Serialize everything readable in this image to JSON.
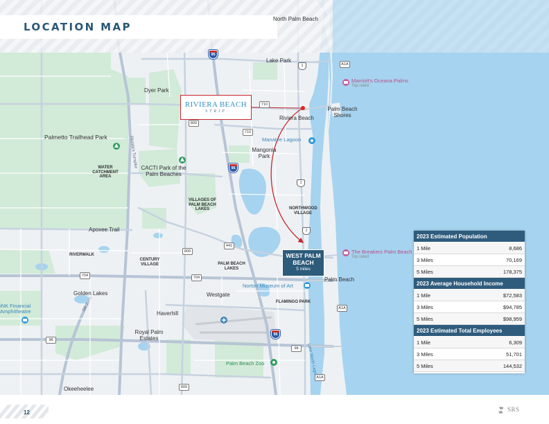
{
  "header": {
    "title": "LOCATION MAP"
  },
  "logos": {
    "riviera_name": "RIVIERA BEACH",
    "riviera_sub": "STRIP"
  },
  "target": {
    "name_line1": "WEST PALM",
    "name_line2": "BEACH",
    "distance": "5 miles"
  },
  "map_labels": {
    "north_palm_beach": "North Palm Beach",
    "lake_park": "Lake Park",
    "dyer_park": "Dyer Park",
    "palm_beach_shores": "Palm Beach Shores",
    "riviera_beach": "Riviera Beach",
    "palmetto_trailhead": "Palmetto Trailhead Park",
    "manatee_lagoon": "Manatee Lagoon",
    "mangonia_park": "Mangonia Park",
    "water_catchment": "WATER CATCHMENT AREA",
    "cacti_park": "CACTI Park of the Palm Beaches",
    "villages": "VILLAGES OF PALM BEACH LAKES",
    "northwood": "NORTHWOOD VILLAGE",
    "apoxee": "Apoxee Trail",
    "riverwalk": "RIVERWALK",
    "century_village": "CENTURY VILLAGE",
    "palm_beach_lakes": "PALM BEACH LAKES",
    "norton": "Norton Museum of Art",
    "palm_beach": "Palm Beach",
    "golden_lakes": "Golden Lakes",
    "westgate": "Westgate",
    "flamingo_park": "FLAMINGO PARK",
    "ink_financial": "iNK Financial Amphitheatre",
    "haverhill": "Haverhill",
    "royal_palm_estates": "Royal Palm Estates",
    "palm_beach_zoo": "Palm Beach Zoo",
    "okeeheelee": "Okeeheelee",
    "marriott": "Marriott's Oceana Palms",
    "marriott_sub": "Top rated",
    "breakers": "The Breakers Palm Beach",
    "breakers_sub": "Top rated",
    "lake_worth_lagoon": "Lake Worth Lagoon",
    "florida_tpk": "Florida's Turnpike",
    "sr7": "SR 7"
  },
  "road_shields": {
    "i95_a": "95",
    "i95_b": "95",
    "i95_c": "95",
    "us1_a": "1",
    "us1_b": "1",
    "us1_c": "1",
    "a1a_a": "A1A",
    "a1a_b": "A1A",
    "a1a_c": "A1A",
    "sr710_a": "710",
    "sr710_b": "710",
    "sr809_a": "809",
    "sr809_b": "809",
    "sr809_c": "809",
    "sr704_a": "704",
    "sr704_b": "704",
    "sr98_a": "98",
    "sr98_b": "98",
    "sr441": "441"
  },
  "demographics": {
    "population": {
      "title": "2023 Estimated Population",
      "rows": [
        {
          "label": "1 Mile",
          "value": "8,686"
        },
        {
          "label": "3 Miles",
          "value": "70,169"
        },
        {
          "label": "5 Miles",
          "value": "178,375"
        }
      ]
    },
    "income": {
      "title": "2023 Average Household Income",
      "rows": [
        {
          "label": "1 Mile",
          "value": "$72,583"
        },
        {
          "label": "3 Miles",
          "value": "$94,785"
        },
        {
          "label": "5 Miles",
          "value": "$98,959"
        }
      ]
    },
    "employees": {
      "title": "2023 Estimated Total Employees",
      "rows": [
        {
          "label": "1 Mile",
          "value": "6,309"
        },
        {
          "label": "3 Miles",
          "value": "51,701"
        },
        {
          "label": "5 Miles",
          "value": "144,532"
        }
      ]
    }
  },
  "footer": {
    "page_number": "12",
    "brand": "SRS"
  },
  "colors": {
    "ocean": "#a6d3ef",
    "lagoon": "#a6d3ef",
    "land": "#eef1f4",
    "park": "#d2ead8",
    "road_major": "#b6c4d5",
    "road_minor": "#ffffff",
    "header": "#2a5775",
    "target_box": "#2d5b7b",
    "route": "#c9252d"
  }
}
